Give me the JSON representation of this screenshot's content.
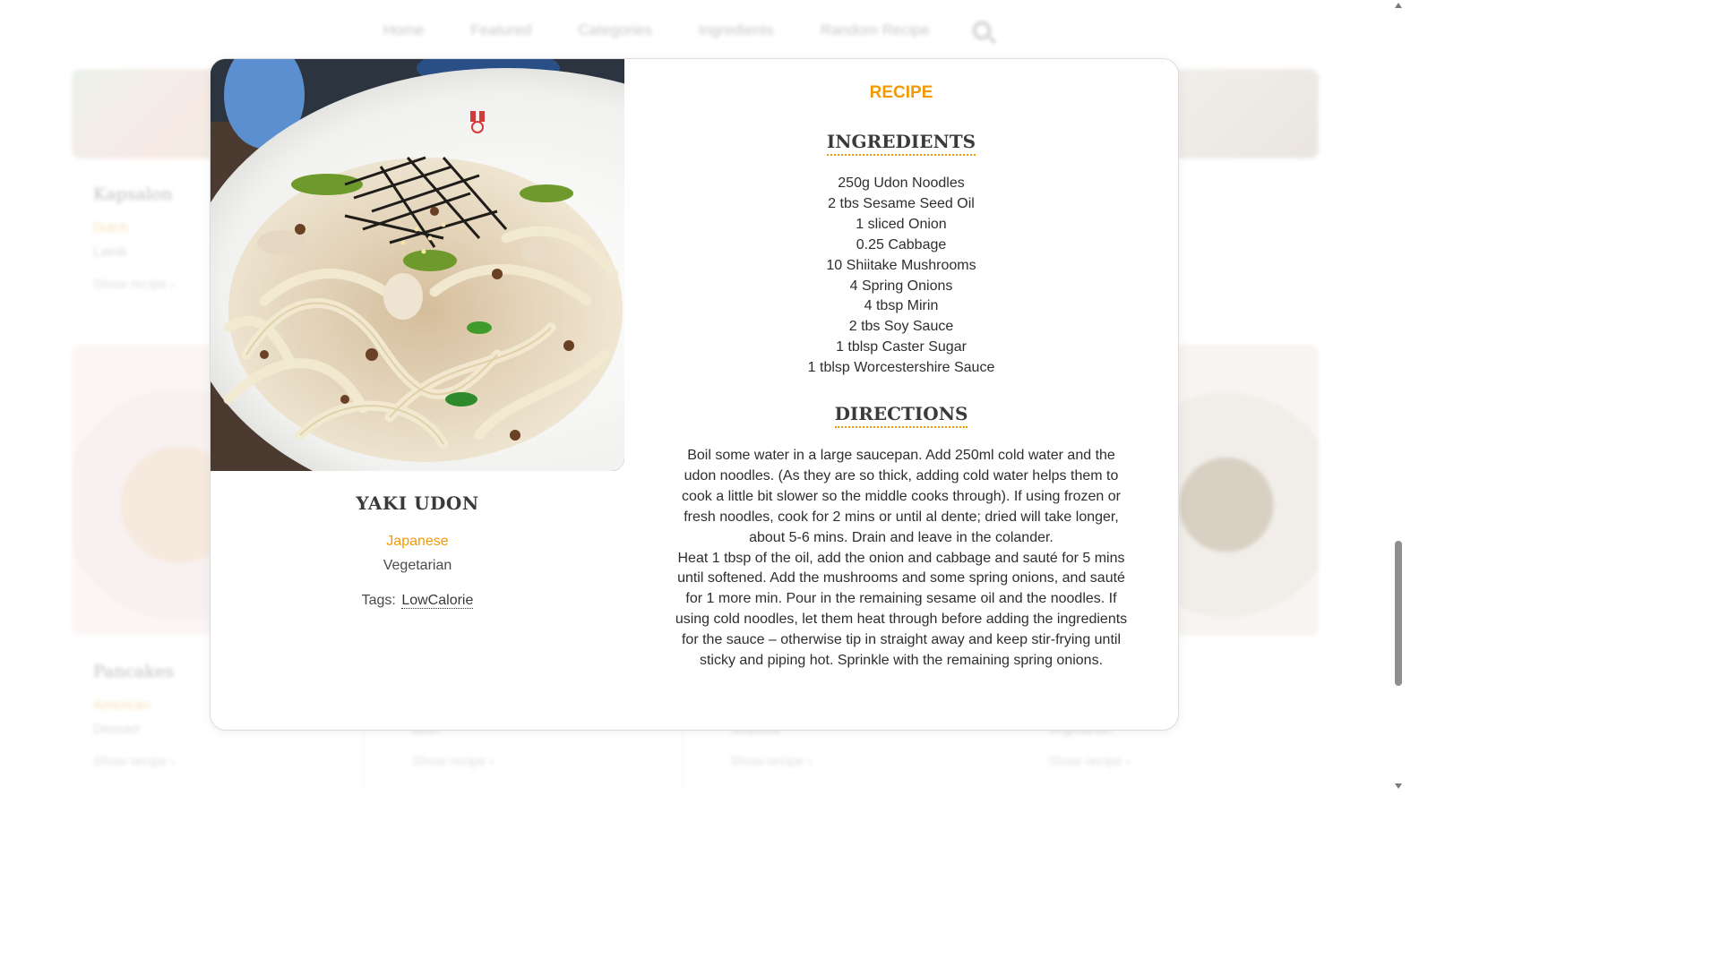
{
  "nav": {
    "items": [
      "Home",
      "Featured",
      "Categories",
      "Ingredients",
      "Random Recipe"
    ],
    "search_icon": "search-icon"
  },
  "background_cards": [
    {
      "title": "Kapsalon",
      "cuisine": "Dutch",
      "type": "Lamb",
      "link": "Show recipe ›"
    },
    {
      "title": "Pancakes",
      "cuisine": "American",
      "type": "Dessert",
      "link": "Show recipe ›"
    },
    {
      "type": "Beef",
      "link": "Show recipe ›"
    },
    {
      "type": "Seafood",
      "link": "Show recipe ›"
    },
    {
      "type": "Vegetarian",
      "link": "Show recipe ›"
    }
  ],
  "modal": {
    "section_label": "RECIPE",
    "title": "YAKI UDON",
    "cuisine": "Japanese",
    "category": "Vegetarian",
    "tags_label": "Tags:",
    "tags": [
      "LowCalorie"
    ],
    "ingredients_heading": "INGREDIENTS",
    "ingredients": [
      "250g Udon Noodles",
      "2 tbs Sesame Seed Oil",
      "1 sliced Onion",
      "0.25 Cabbage",
      "10 Shiitake Mushrooms",
      "4 Spring Onions",
      "4 tbsp Mirin",
      "2 tbs Soy Sauce",
      "1 tblsp Caster Sugar",
      "1 tblsp Worcestershire Sauce"
    ],
    "directions_heading": "DIRECTIONS",
    "directions": [
      "Boil some water in a large saucepan. Add 250ml cold water and the udon noodles. (As they are so thick, adding cold water helps them to cook a little bit slower so the middle cooks through). If using frozen or fresh noodles, cook for 2 mins or until al dente; dried will take longer, about 5-6 mins. Drain and leave in the colander.",
      "Heat 1 tbsp of the oil, add the onion and cabbage and sauté for 5 mins until softened. Add the mushrooms and some spring onions, and sauté for 1 more min. Pour in the remaining sesame oil and the noodles. If using cold noodles, let them heat through before adding the ingredients for the sauce – otherwise tip in straight away and keep stir-frying until sticky and piping hot. Sprinkle with the remaining spring onions."
    ]
  },
  "colors": {
    "accent": "#f29a06",
    "heading": "#3a3a3a",
    "text": "#2e2e2e"
  }
}
